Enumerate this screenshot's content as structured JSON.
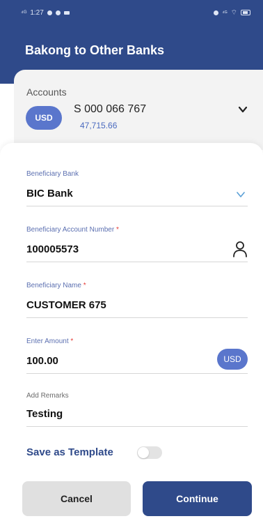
{
  "status_bar": {
    "time": "1:27",
    "signal_text": "⁴ᴳ",
    "icons_left": [
      "signal-icon",
      "notification-dot-icon",
      "notification-dot-icon",
      "message-icon"
    ],
    "icons_right": [
      "alarm-icon",
      "network-icon",
      "wifi-icon",
      "battery-icon"
    ]
  },
  "header": {
    "title": "Bakong to Other Banks",
    "color": "#2f4a8a"
  },
  "account": {
    "label": "Accounts",
    "currency": "USD",
    "number": "S 000 066 767",
    "balance": "47,715.66"
  },
  "form": {
    "beneficiary_bank": {
      "label": "Beneficiary Bank",
      "value": "BIC Bank"
    },
    "account_number": {
      "label": "Beneficiary Account Number",
      "required": "*",
      "value": "100005573"
    },
    "beneficiary_name": {
      "label": "Beneficiary Name",
      "required": "*",
      "value": "CUSTOMER 675"
    },
    "amount": {
      "label": "Enter Amount",
      "required": "*",
      "value": "100.00",
      "currency": "USD"
    },
    "remarks": {
      "label": "Add Remarks",
      "value": "Testing"
    }
  },
  "save_template": {
    "label": "Save as Template",
    "enabled": false
  },
  "buttons": {
    "cancel": "Cancel",
    "continue": "Continue"
  },
  "colors": {
    "primary": "#2f4a8a",
    "accent": "#5a76cc",
    "required": "#e53935"
  }
}
